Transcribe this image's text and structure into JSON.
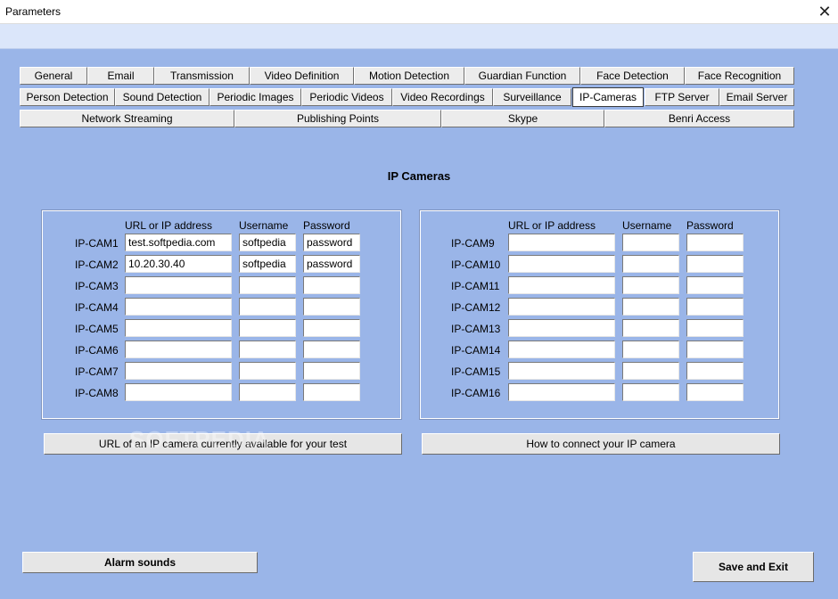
{
  "window": {
    "title": "Parameters",
    "close_glyph": "✕"
  },
  "tabs_row1": [
    "General",
    "Email",
    "Transmission",
    "Video Definition",
    "Motion Detection",
    "Guardian Function",
    "Face Detection",
    "Face Recognition"
  ],
  "tabs_row2": [
    "Person Detection",
    "Sound Detection",
    "Periodic Images",
    "Periodic Videos",
    "Video Recordings",
    "Surveillance",
    "IP-Cameras",
    "FTP Server",
    "Email Server"
  ],
  "tabs_row3": [
    "Network Streaming",
    "Publishing Points",
    "Skype",
    "Benri Access"
  ],
  "active_tab": "IP-Cameras",
  "section_title": "IP Cameras",
  "columns": {
    "url": "URL or IP address",
    "username": "Username",
    "password": "Password"
  },
  "cams_left": [
    {
      "label": "IP-CAM1",
      "url": "test.softpedia.com",
      "username": "softpedia",
      "password": "password"
    },
    {
      "label": "IP-CAM2",
      "url": "10.20.30.40",
      "username": "softpedia",
      "password": "password"
    },
    {
      "label": "IP-CAM3",
      "url": "",
      "username": "",
      "password": ""
    },
    {
      "label": "IP-CAM4",
      "url": "",
      "username": "",
      "password": ""
    },
    {
      "label": "IP-CAM5",
      "url": "",
      "username": "",
      "password": ""
    },
    {
      "label": "IP-CAM6",
      "url": "",
      "username": "",
      "password": ""
    },
    {
      "label": "IP-CAM7",
      "url": "",
      "username": "",
      "password": ""
    },
    {
      "label": "IP-CAM8",
      "url": "",
      "username": "",
      "password": ""
    }
  ],
  "cams_right": [
    {
      "label": "IP-CAM9",
      "url": "",
      "username": "",
      "password": ""
    },
    {
      "label": "IP-CAM10",
      "url": "",
      "username": "",
      "password": ""
    },
    {
      "label": "IP-CAM11",
      "url": "",
      "username": "",
      "password": ""
    },
    {
      "label": "IP-CAM12",
      "url": "",
      "username": "",
      "password": ""
    },
    {
      "label": "IP-CAM13",
      "url": "",
      "username": "",
      "password": ""
    },
    {
      "label": "IP-CAM14",
      "url": "",
      "username": "",
      "password": ""
    },
    {
      "label": "IP-CAM15",
      "url": "",
      "username": "",
      "password": ""
    },
    {
      "label": "IP-CAM16",
      "url": "",
      "username": "",
      "password": ""
    }
  ],
  "buttons": {
    "test_url": "URL of an IP camera currently available for your test",
    "how_to": "How to connect your IP camera",
    "alarm_sounds": "Alarm sounds",
    "save_exit": "Save and Exit"
  },
  "watermark": "SOFTPEDIA",
  "colors": {
    "background": "#9ab5e8",
    "title_strip": "#dbe6fa",
    "tab_face": "#ececec"
  }
}
